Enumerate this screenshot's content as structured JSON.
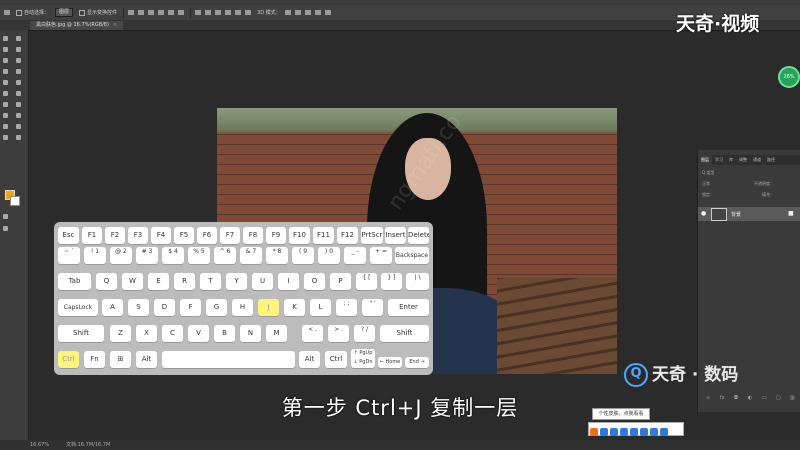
{
  "options_bar": {
    "auto_select_label": "自动选择：",
    "auto_select_target": "图层",
    "show_transform_label": "显示变换控件",
    "mode_3d_label": "3D 模式："
  },
  "document_tab": {
    "title": "黑白肤色.jpg @ 16.7%(RGB/8)",
    "close": "×"
  },
  "keyboard": {
    "rows": [
      [
        "Esc",
        "F1",
        "F2",
        "F3",
        "F4",
        "F5",
        "F6",
        "F7",
        "F8",
        "F9",
        "F10",
        "F11",
        "F12",
        "PrtScr",
        "Insert",
        "Delete"
      ],
      [
        "~ `",
        "! 1",
        "@ 2",
        "# 3",
        "$ 4",
        "% 5",
        "^ 6",
        "& 7",
        "* 8",
        "( 9",
        ") 0",
        "_ -",
        "+ =",
        "Backspace"
      ],
      [
        "Tab",
        "Q",
        "W",
        "E",
        "R",
        "T",
        "Y",
        "U",
        "I",
        "O",
        "P",
        "{ [",
        "} ]",
        "| \\"
      ],
      [
        "CapsLock",
        "A",
        "S",
        "D",
        "F",
        "G",
        "H",
        "J",
        "K",
        "L",
        ": ;",
        "\" '",
        "Enter"
      ],
      [
        "Shift",
        "Z",
        "X",
        "C",
        "V",
        "B",
        "N",
        "M",
        "< ,",
        "> .",
        "? /",
        "Shift"
      ],
      [
        "Ctrl",
        "Fn",
        "⊞",
        "Alt",
        "",
        "Alt",
        "Ctrl",
        "↑ PgUp ↓ PgDn",
        "← Home",
        "End →"
      ]
    ],
    "highlighted": [
      "Ctrl",
      "J"
    ]
  },
  "layers_panel": {
    "tabs": [
      "图层",
      "学习",
      "库",
      "调整",
      "通道",
      "路径"
    ],
    "kind_label": "Q 类型",
    "blend_mode": "正常",
    "opacity_label": "不透明度：",
    "lock_label": "锁定：",
    "fill_label": "填充：",
    "layer_name": "背景"
  },
  "status_bar": {
    "zoom": "16.67%",
    "doc_size": "文档:16.7M/16.7M"
  },
  "subtitle": "第一步 Ctrl+J 复制一层",
  "brand_top": "天奇·视频",
  "brand_bottom": "天奇 · 数码",
  "brand_bottom_icon": "Q",
  "badge_percent": "26%",
  "ime_tooltip": "个性皮肤，点我看看",
  "colors": {
    "foreground": "#f5a30a",
    "background": "#ffffff",
    "key_highlight": "#fff57a"
  }
}
